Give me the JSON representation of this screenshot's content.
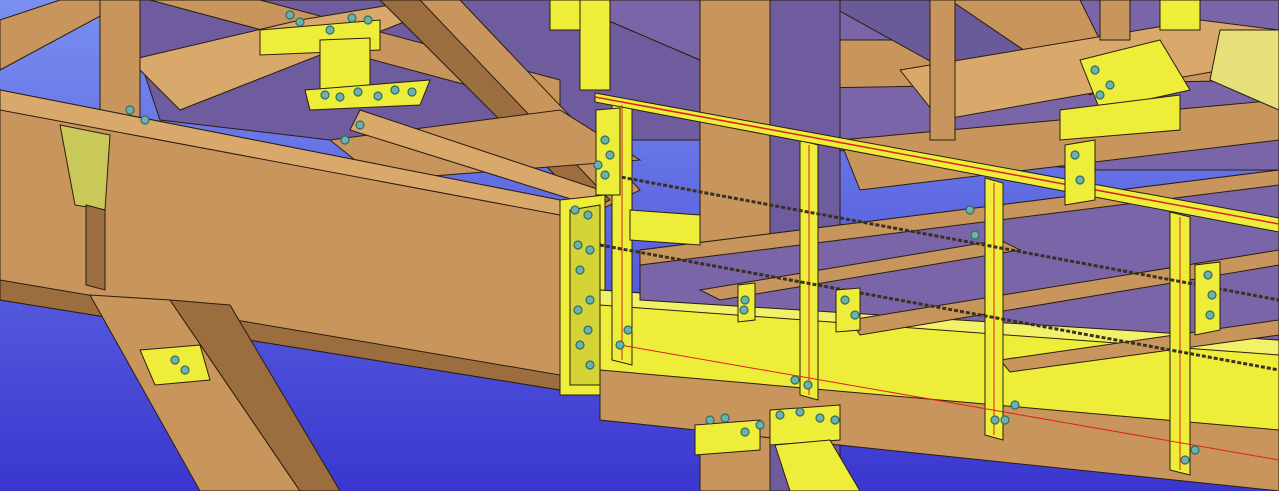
{
  "viewport": {
    "description_free": true,
    "colors": {
      "background_top": "#6f86e8",
      "background_bottom": "#3c3cd0",
      "steel": "#c8955c",
      "steel_light": "#d9a96b",
      "steel_dark": "#9c6e3f",
      "steel_shadow": "#7f5a35",
      "purple_shadow": "#6f5c9e",
      "purple_dark": "#5a4a86",
      "plate_yellow": "#eded3a",
      "plate_yellow_dark": "#c9c92a",
      "bolt": "#6fb0a8",
      "bolt_dark": "#2f6e68",
      "rail_line": "#e02020",
      "edge": "#2a1e10"
    },
    "icons": {
      "bolt": "bolt-icon"
    }
  }
}
